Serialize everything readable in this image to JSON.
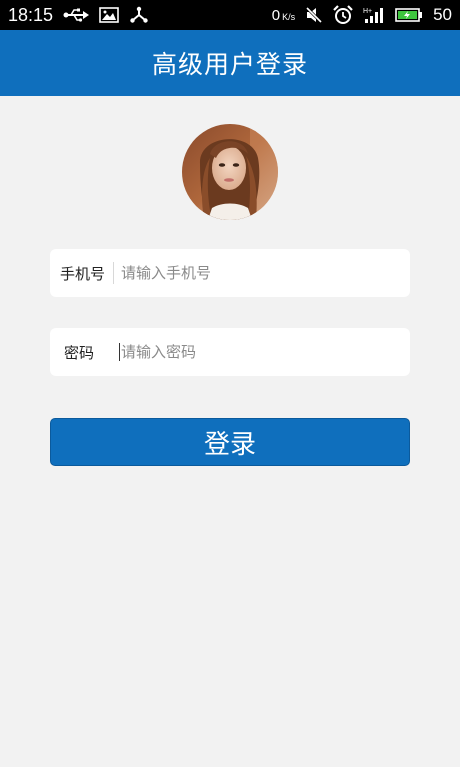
{
  "status_bar": {
    "time": "18:15",
    "net_speed": "0",
    "net_speed_unit": "K/s",
    "battery_level": "50",
    "icons": [
      "usb-icon",
      "image-icon",
      "share-icon",
      "mute-icon",
      "alarm-icon",
      "signal-icon",
      "battery-icon"
    ]
  },
  "header": {
    "title": "高级用户登录"
  },
  "form": {
    "phone_label": "手机号",
    "phone_placeholder": "请输入手机号",
    "password_label": "密码",
    "password_placeholder": "请输入密码",
    "login_label": "登录"
  },
  "colors": {
    "primary": "#0f6fbd",
    "background": "#f2f2f2",
    "status_bar": "#000000"
  }
}
